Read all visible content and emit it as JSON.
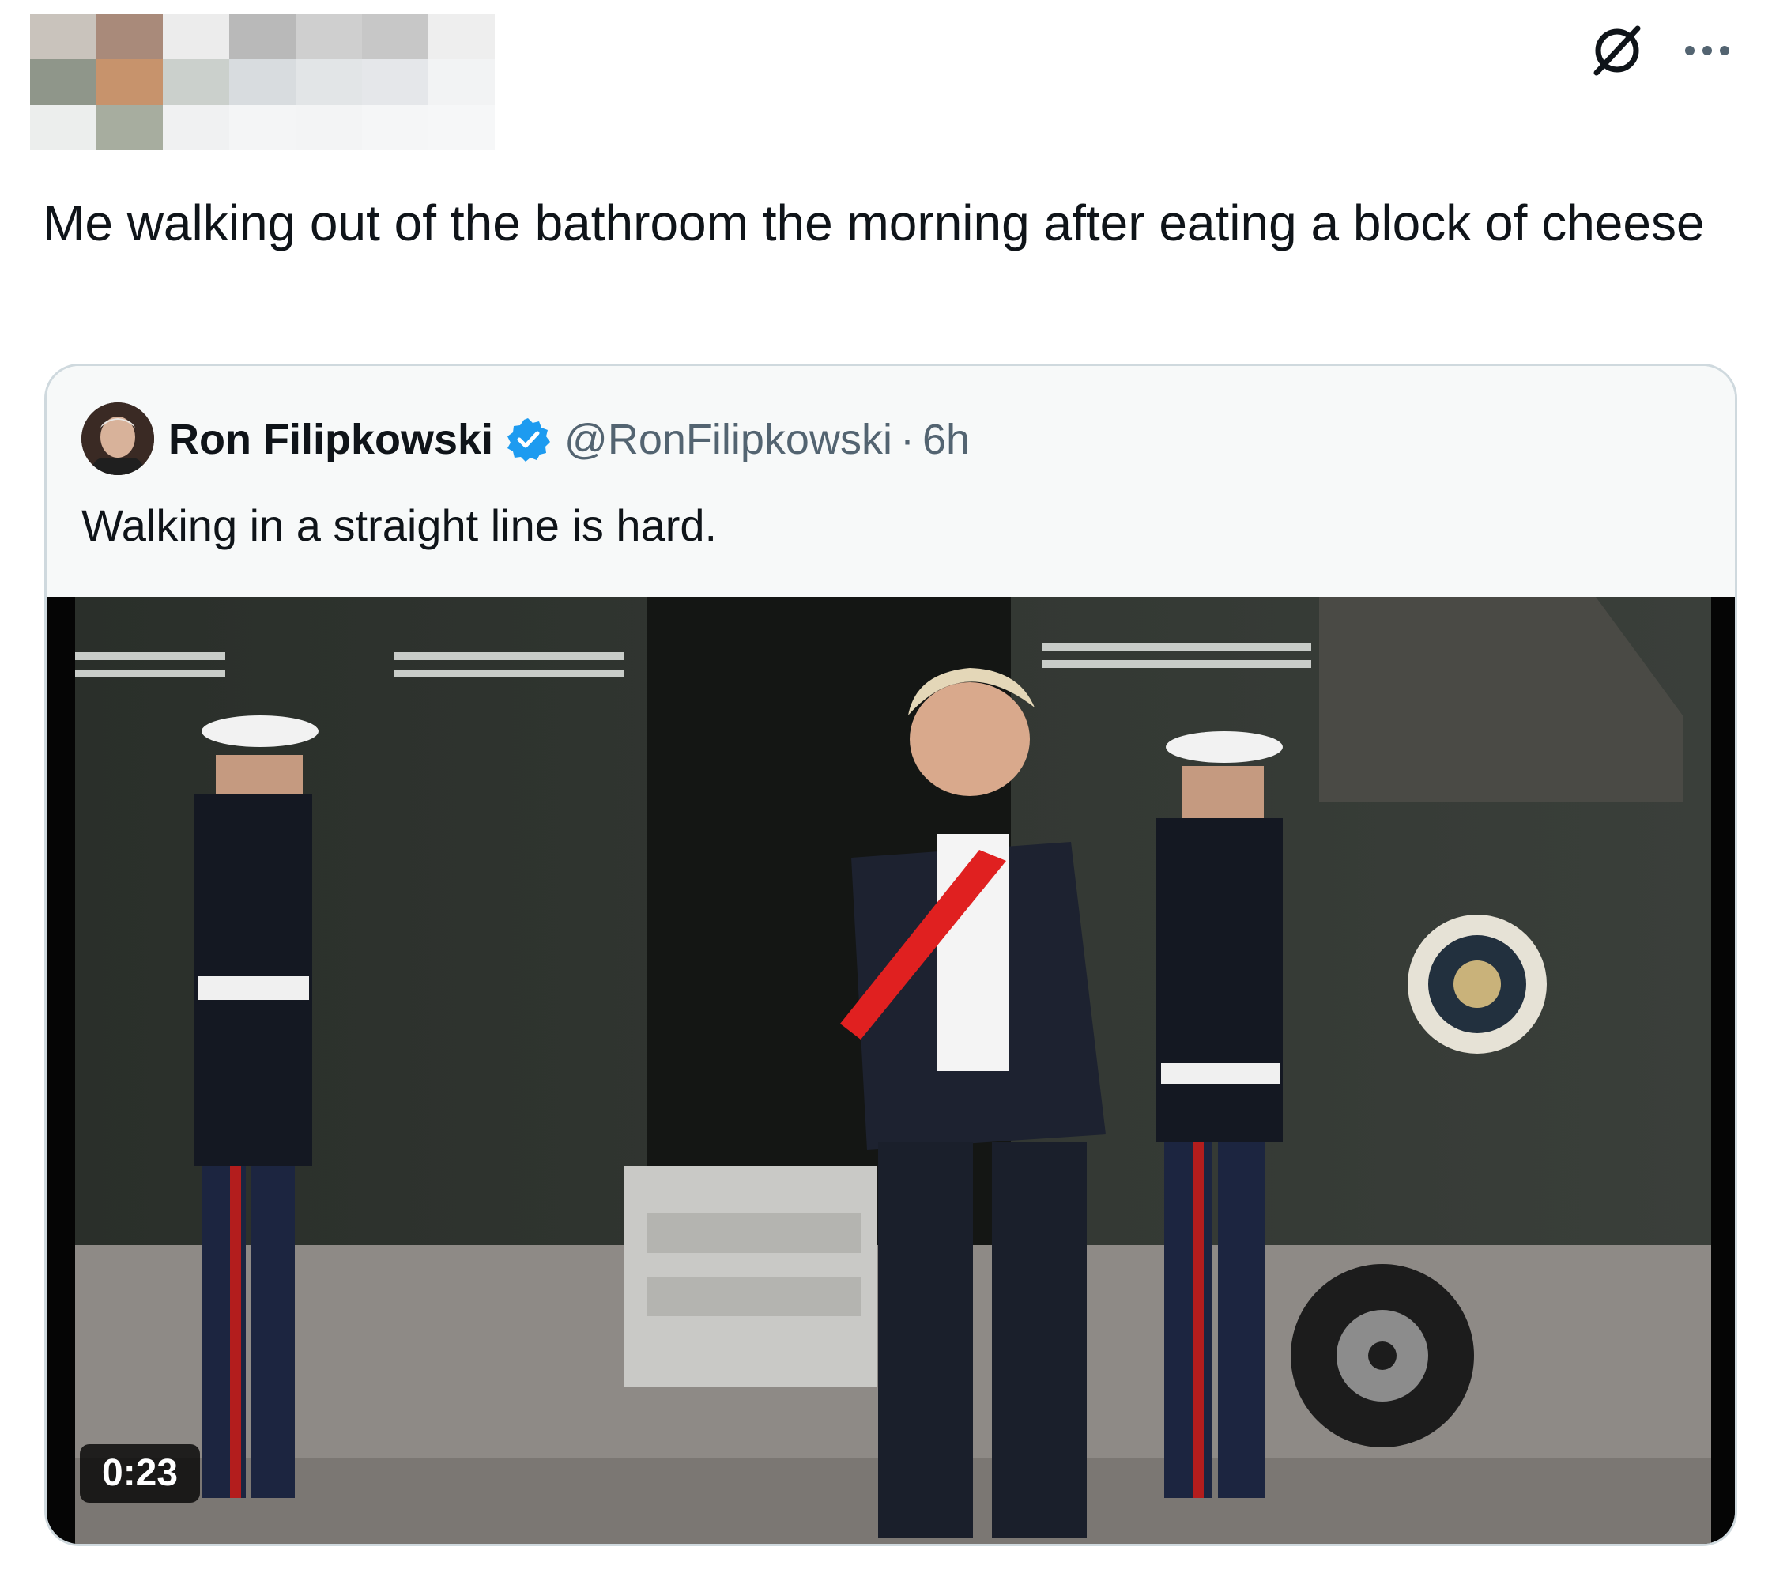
{
  "header": {
    "pixelated_colors": [
      [
        "#c9c3bc",
        "#a98a7a",
        "#ececec",
        "#b9b9b9",
        "#cfcfcf",
        "#c7c7c7",
        "#eeeeee"
      ],
      [
        "#8f968a",
        "#c7936c",
        "#cbd0cc",
        "#d8dcdf",
        "#e2e5e7",
        "#e5e7ea",
        "#f2f3f4"
      ],
      [
        "#eceeed",
        "#a7ad9f",
        "#f0f1f2",
        "#f4f5f6",
        "#f3f4f5",
        "#f5f6f7",
        "#f6f7f8"
      ]
    ],
    "grok_icon": "grok-icon",
    "more_icon": "more-icon"
  },
  "tweet": {
    "text": "Me walking out of the bathroom the morning after eating a block of cheese"
  },
  "quoted_tweet": {
    "author_name": "Ron Filipkowski",
    "verified_icon": "verified-badge-icon",
    "handle": "@RonFilipkowski",
    "separator": "·",
    "time": "6h",
    "text": "Walking in a straight line is hard.",
    "video": {
      "duration": "0:23"
    }
  },
  "colors": {
    "text": "#0f1419",
    "secondary": "#536471",
    "border": "#cfd9de",
    "verified": "#1d9bf0",
    "quote_bg": "#f7f9f9"
  }
}
